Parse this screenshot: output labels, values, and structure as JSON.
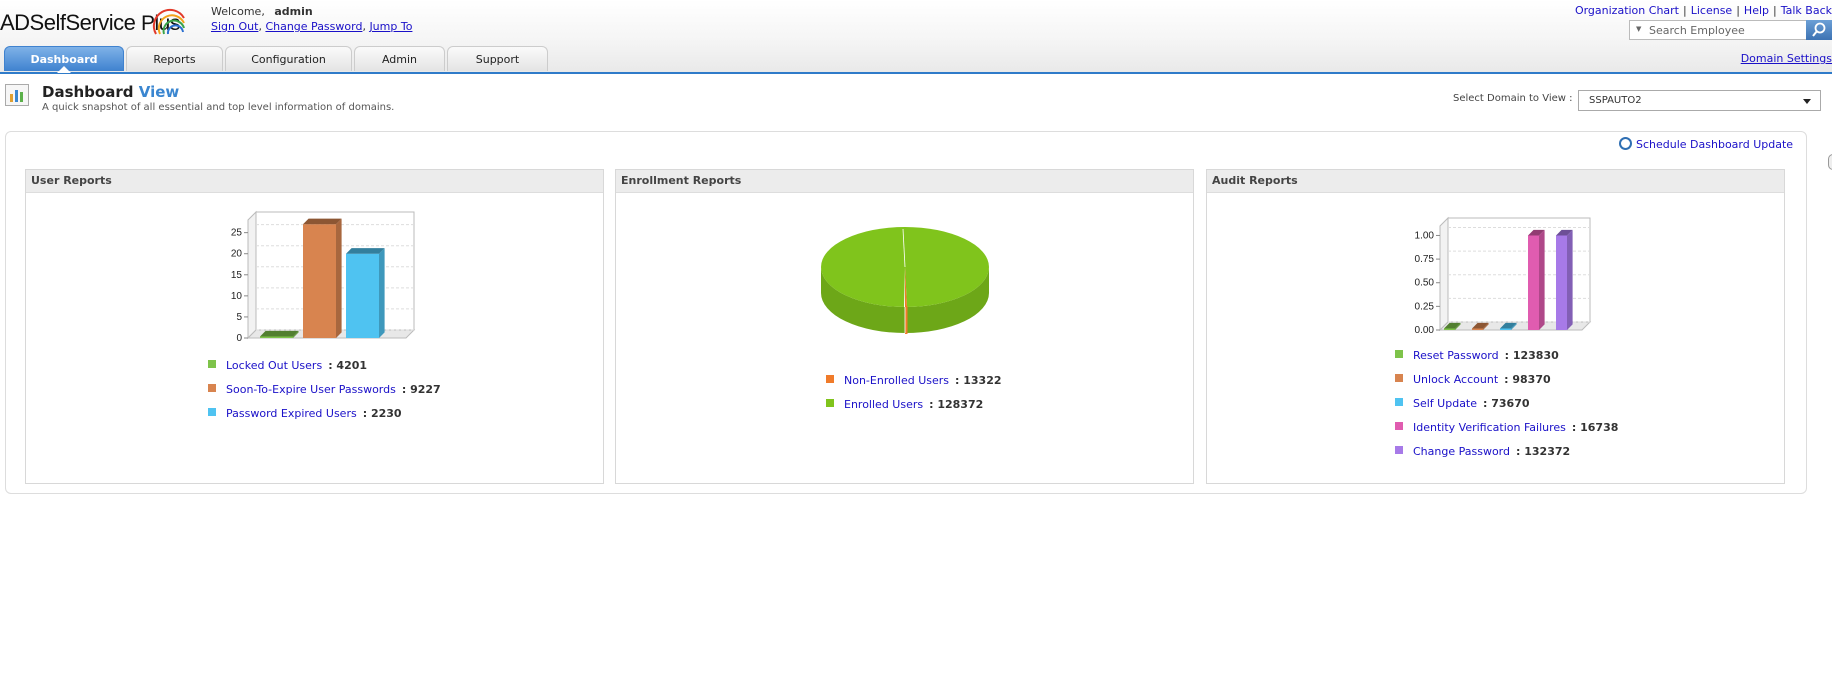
{
  "app": {
    "logo_text": "ADSelfService",
    "logo_plus": "Plus",
    "welcome_label": "Welcome,",
    "username": "admin",
    "sign_out": "Sign Out",
    "change_password": "Change Password",
    "jump_to": "Jump To"
  },
  "toplinks": [
    "Organization Chart",
    "License",
    "Help",
    "Talk Back"
  ],
  "search": {
    "placeholder": "Search Employee"
  },
  "domain_settings": "Domain Settings",
  "tabs": [
    {
      "label": "Dashboard",
      "active": true
    },
    {
      "label": "Reports"
    },
    {
      "label": "Configuration"
    },
    {
      "label": "Admin"
    },
    {
      "label": "Support"
    }
  ],
  "page": {
    "title": "Dashboard",
    "title_accent": "View",
    "subtitle": "A quick snapshot of all essential and top level information of domains.",
    "domain_label": "Select Domain to View :",
    "domain_value": "SSPAUTO2",
    "schedule_link": "Schedule Dashboard Update"
  },
  "panels": {
    "user": {
      "title": "User Reports"
    },
    "enrollment": {
      "title": "Enrollment Reports"
    },
    "audit": {
      "title": "Audit Reports"
    }
  },
  "chart_data": [
    {
      "type": "bar",
      "title": "User Reports",
      "yticks": [
        "0",
        "5",
        "10",
        "15",
        "20",
        "25"
      ],
      "ylim": [
        0,
        28
      ],
      "series": [
        {
          "name": "Locked Out Users",
          "value": 0,
          "color": "#7ec34a",
          "legend_value": "4201"
        },
        {
          "name": "Soon-To-Expire User Passwords",
          "value": 27,
          "color": "#d8844f",
          "legend_value": "9227"
        },
        {
          "name": "Password Expired Users",
          "value": 20,
          "color": "#4fc3f1",
          "legend_value": "2230"
        }
      ]
    },
    {
      "type": "pie",
      "title": "Enrollment Reports",
      "series": [
        {
          "name": "Non-Enrolled Users",
          "value": 13322,
          "color": "#f07b2a",
          "legend_value": "13322"
        },
        {
          "name": "Enrolled Users",
          "value": 128372,
          "color": "#80c41c",
          "legend_value": "128372"
        }
      ]
    },
    {
      "type": "bar",
      "title": "Audit Reports",
      "yticks": [
        "0.00",
        "0.25",
        "0.50",
        "0.75",
        "1.00"
      ],
      "ylim": [
        0,
        1.1
      ],
      "series": [
        {
          "name": "Reset Password",
          "value": 0,
          "color": "#7ec34a",
          "legend_value": "123830"
        },
        {
          "name": "Unlock Account",
          "value": 0,
          "color": "#d8844f",
          "legend_value": "98370"
        },
        {
          "name": "Self Update",
          "value": 0,
          "color": "#4fc3f1",
          "legend_value": "73670"
        },
        {
          "name": "Identity Verification Failures",
          "value": 1.0,
          "color": "#e05cb0",
          "legend_value": "16738"
        },
        {
          "name": "Change Password",
          "value": 1.0,
          "color": "#a77ae8",
          "legend_value": "132372"
        }
      ]
    }
  ]
}
